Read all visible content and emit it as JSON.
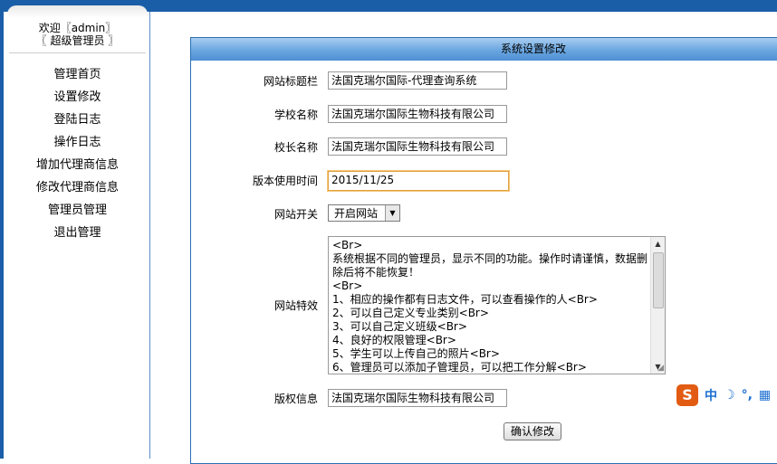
{
  "sidebar": {
    "welcome_line1": "欢迎〖admin〗",
    "welcome_line2": "〖 超级管理员 〗",
    "items": [
      {
        "label": "管理首页"
      },
      {
        "label": "设置修改"
      },
      {
        "label": "登陆日志"
      },
      {
        "label": "操作日志"
      },
      {
        "label": "增加代理商信息"
      },
      {
        "label": "修改代理商信息"
      },
      {
        "label": "管理员管理"
      },
      {
        "label": "退出管理"
      }
    ]
  },
  "panel": {
    "title": "系统设置修改",
    "fields": {
      "site_title": {
        "label": "网站标题栏",
        "value": "法国克瑞尔国际-代理查询系统"
      },
      "school_name": {
        "label": "学校名称",
        "value": "法国克瑞尔国际生物科技有限公司"
      },
      "principal_name": {
        "label": "校长名称",
        "value": "法国克瑞尔国际生物科技有限公司"
      },
      "version_time": {
        "label": "版本使用时间",
        "value": "2015/11/25"
      },
      "site_switch": {
        "label": "网站开关",
        "value": "开启网站"
      },
      "site_features": {
        "label": "网站特效",
        "value": "<Br>\n系统根据不同的管理员，显示不同的功能。操作时请谨慎，数据删除后将不能恢复！\n<Br>\n1、相应的操作都有日志文件，可以查看操作的人<Br>\n2、可以自己定义专业类别<Br>\n3、可以自己定义班级<Br>\n4、良好的权限管理<Br>\n5、学生可以上传自己的照片<Br>\n6、管理员可以添加子管理员，可以把工作分解<Br>"
      },
      "copyright": {
        "label": "版权信息",
        "value": "法国克瑞尔国际生物科技有限公司"
      }
    },
    "submit_label": "确认修改"
  },
  "ime": {
    "logo": "S",
    "lang": "中",
    "moon": "☽",
    "punct": "°,",
    "keyboard": "▦"
  },
  "colors": {
    "topbar": "#1a5ea8",
    "panel_header": "#6aa6e0",
    "ime_logo": "#e25b12"
  }
}
